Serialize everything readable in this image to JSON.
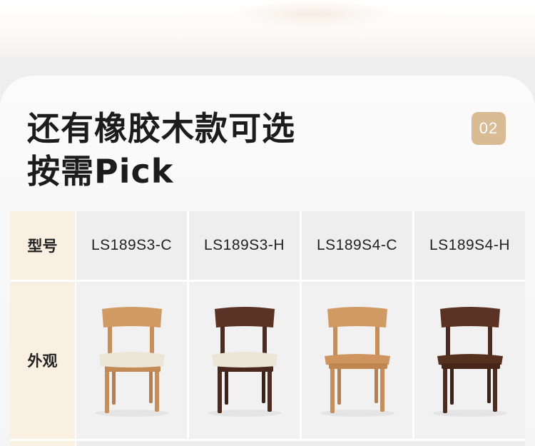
{
  "section": {
    "title_line1": "还有橡胶木款可选",
    "title_line2": "按需Pick",
    "badge": "02"
  },
  "table": {
    "row_labels": {
      "model": "型号",
      "appearance": "外观"
    },
    "models": [
      "LS189S3-C",
      "LS189S3-H",
      "LS189S4-C",
      "LS189S4-H"
    ],
    "chairs": [
      {
        "model": "LS189S3-C",
        "wood": "natural",
        "seat": "cream-cushion"
      },
      {
        "model": "LS189S3-H",
        "wood": "walnut",
        "seat": "cream-cushion"
      },
      {
        "model": "LS189S4-C",
        "wood": "natural",
        "seat": "solid-wood"
      },
      {
        "model": "LS189S4-H",
        "wood": "walnut",
        "seat": "solid-wood"
      }
    ]
  },
  "colors": {
    "accent_badge": "#d9bc94",
    "header_col": "#faf0e2",
    "natural_wood": "#d29a63",
    "walnut_wood": "#5a3325",
    "cushion": "#ece6d8"
  }
}
